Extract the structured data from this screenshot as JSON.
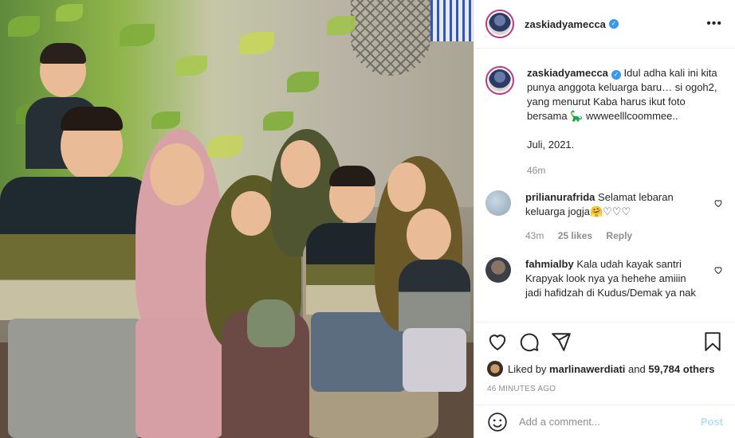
{
  "post": {
    "username": "zaskiadyamecca",
    "caption": "Idul adha kali ini kita punya anggota keluarga baru… si ogoh2, yang menurut Kaba harus ikut foto bersama",
    "caption_emoji": "🦕",
    "caption_tail": "wwweelllcoommee..",
    "caption_date": "Juli, 2021.",
    "caption_age": "46m"
  },
  "comments": [
    {
      "username": "prilianurafrida",
      "text": "Selamat lebaran keluarga jogja",
      "emojis": "🤗♡♡♡",
      "age": "43m",
      "likes": "25 likes",
      "reply": "Reply"
    },
    {
      "username": "fahmialby",
      "text": "Kala udah kayak santri Krapyak look nya ya hehehe amiiin jadi hafidzah di Kudus/Demak ya nak"
    }
  ],
  "liked_by": {
    "prefix": "Liked by",
    "user": "marlinawerdiati",
    "and": "and",
    "others": "59,784 others"
  },
  "timestamp": "46 MINUTES AGO",
  "add_comment": {
    "placeholder": "Add a comment...",
    "post_label": "Post"
  },
  "icons": {
    "header_more": "more-icon",
    "like": "heart-icon",
    "comment": "comment-icon",
    "share": "share-icon",
    "save": "bookmark-icon",
    "emoji": "smiley-icon",
    "comment_like": "small-heart-icon",
    "verified": "verified-badge-icon"
  },
  "colors": {
    "verified": "#3897f0",
    "post_disabled": "#b2dffc",
    "muted_text": "#8e8e8e",
    "story_ring": "#c13584"
  }
}
